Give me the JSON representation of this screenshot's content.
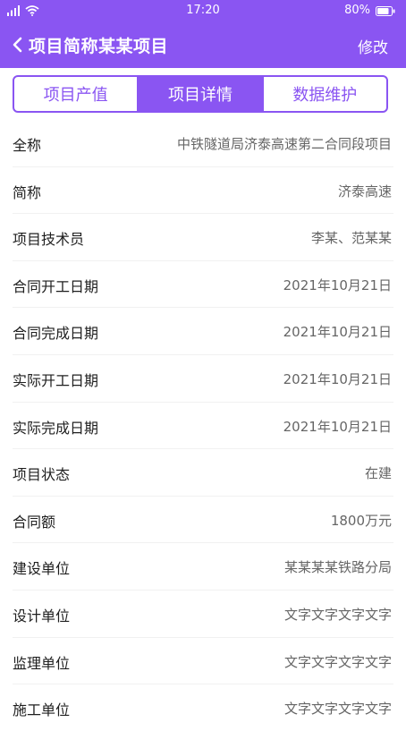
{
  "status_bar": {
    "time": "17:20",
    "battery": "80%",
    "icons": [
      "signal-icon",
      "wifi-icon",
      "battery-icon"
    ]
  },
  "nav": {
    "back_icon": "chevron-left-icon",
    "title": "项目简称某某项目",
    "edit_label": "修改"
  },
  "tabs": [
    {
      "label": "项目产值",
      "active": false
    },
    {
      "label": "项目详情",
      "active": true
    },
    {
      "label": "数据维护",
      "active": false
    }
  ],
  "details": [
    {
      "label": "全称",
      "value": "中铁隧道局济泰高速第二合同段项目"
    },
    {
      "label": "简称",
      "value": "济泰高速"
    },
    {
      "label": "项目技术员",
      "value": "李某、范某某"
    },
    {
      "label": "合同开工日期",
      "value": "2021年10月21日"
    },
    {
      "label": "合同完成日期",
      "value": "2021年10月21日"
    },
    {
      "label": "实际开工日期",
      "value": "2021年10月21日"
    },
    {
      "label": "实际完成日期",
      "value": "2021年10月21日"
    },
    {
      "label": "项目状态",
      "value": "在建"
    },
    {
      "label": "合同额",
      "value": "1800万元"
    },
    {
      "label": "建设单位",
      "value": "某某某某铁路分局"
    },
    {
      "label": "设计单位",
      "value": "文字文字文字文字"
    },
    {
      "label": "监理单位",
      "value": "文字文字文字文字"
    },
    {
      "label": "施工单位",
      "value": "文字文字文字文字"
    }
  ],
  "colors": {
    "accent": "#8a55f2",
    "label_text": "#1f1f1f",
    "value_text": "#666666",
    "divider": "#f1f1f1"
  }
}
